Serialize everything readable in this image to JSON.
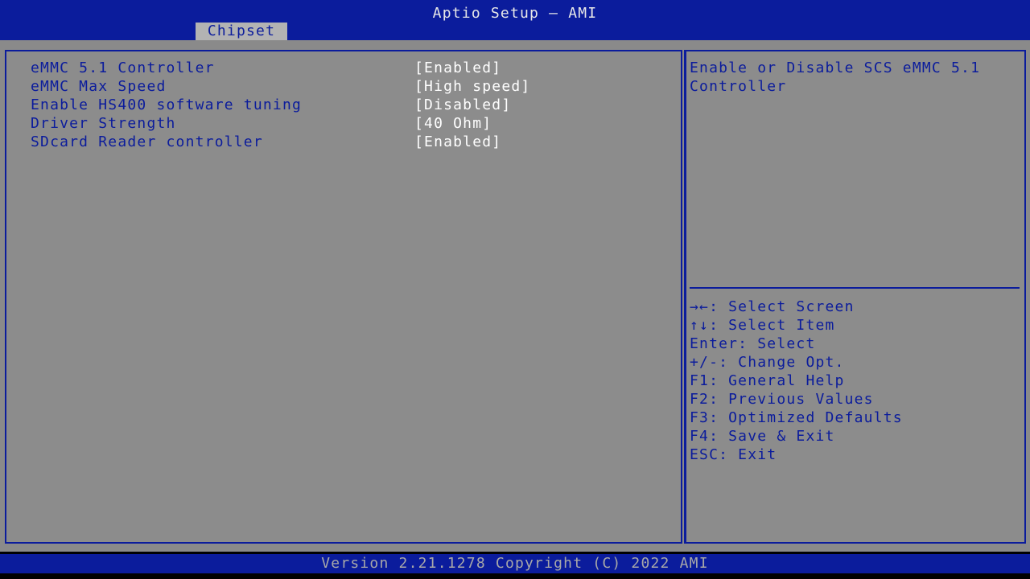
{
  "header": {
    "title": "Aptio Setup – AMI",
    "active_tab": "Chipset"
  },
  "settings": [
    {
      "label": "eMMC 5.1 Controller",
      "value": "[Enabled]"
    },
    {
      "label": "eMMC Max Speed",
      "value": "[High speed]"
    },
    {
      "label": "Enable HS400 software tuning",
      "value": "[Disabled]"
    },
    {
      "label": "Driver Strength",
      "value": "[40 Ohm]"
    },
    {
      "label": "SDcard Reader controller",
      "value": "[Enabled]"
    }
  ],
  "help": {
    "text": "Enable or Disable SCS eMMC 5.1 Controller"
  },
  "keys": [
    "→←: Select Screen",
    "↑↓: Select Item",
    "Enter: Select",
    "+/-: Change Opt.",
    "F1: General Help",
    "F2: Previous Values",
    "F3: Optimized Defaults",
    "F4: Save & Exit",
    "ESC: Exit"
  ],
  "footer": {
    "text": "Version 2.21.1278 Copyright (C) 2022 AMI"
  },
  "colors": {
    "accent_blue": "#0b1c9c",
    "panel_gray": "#8c8c8c",
    "value_white": "#ffffff"
  }
}
